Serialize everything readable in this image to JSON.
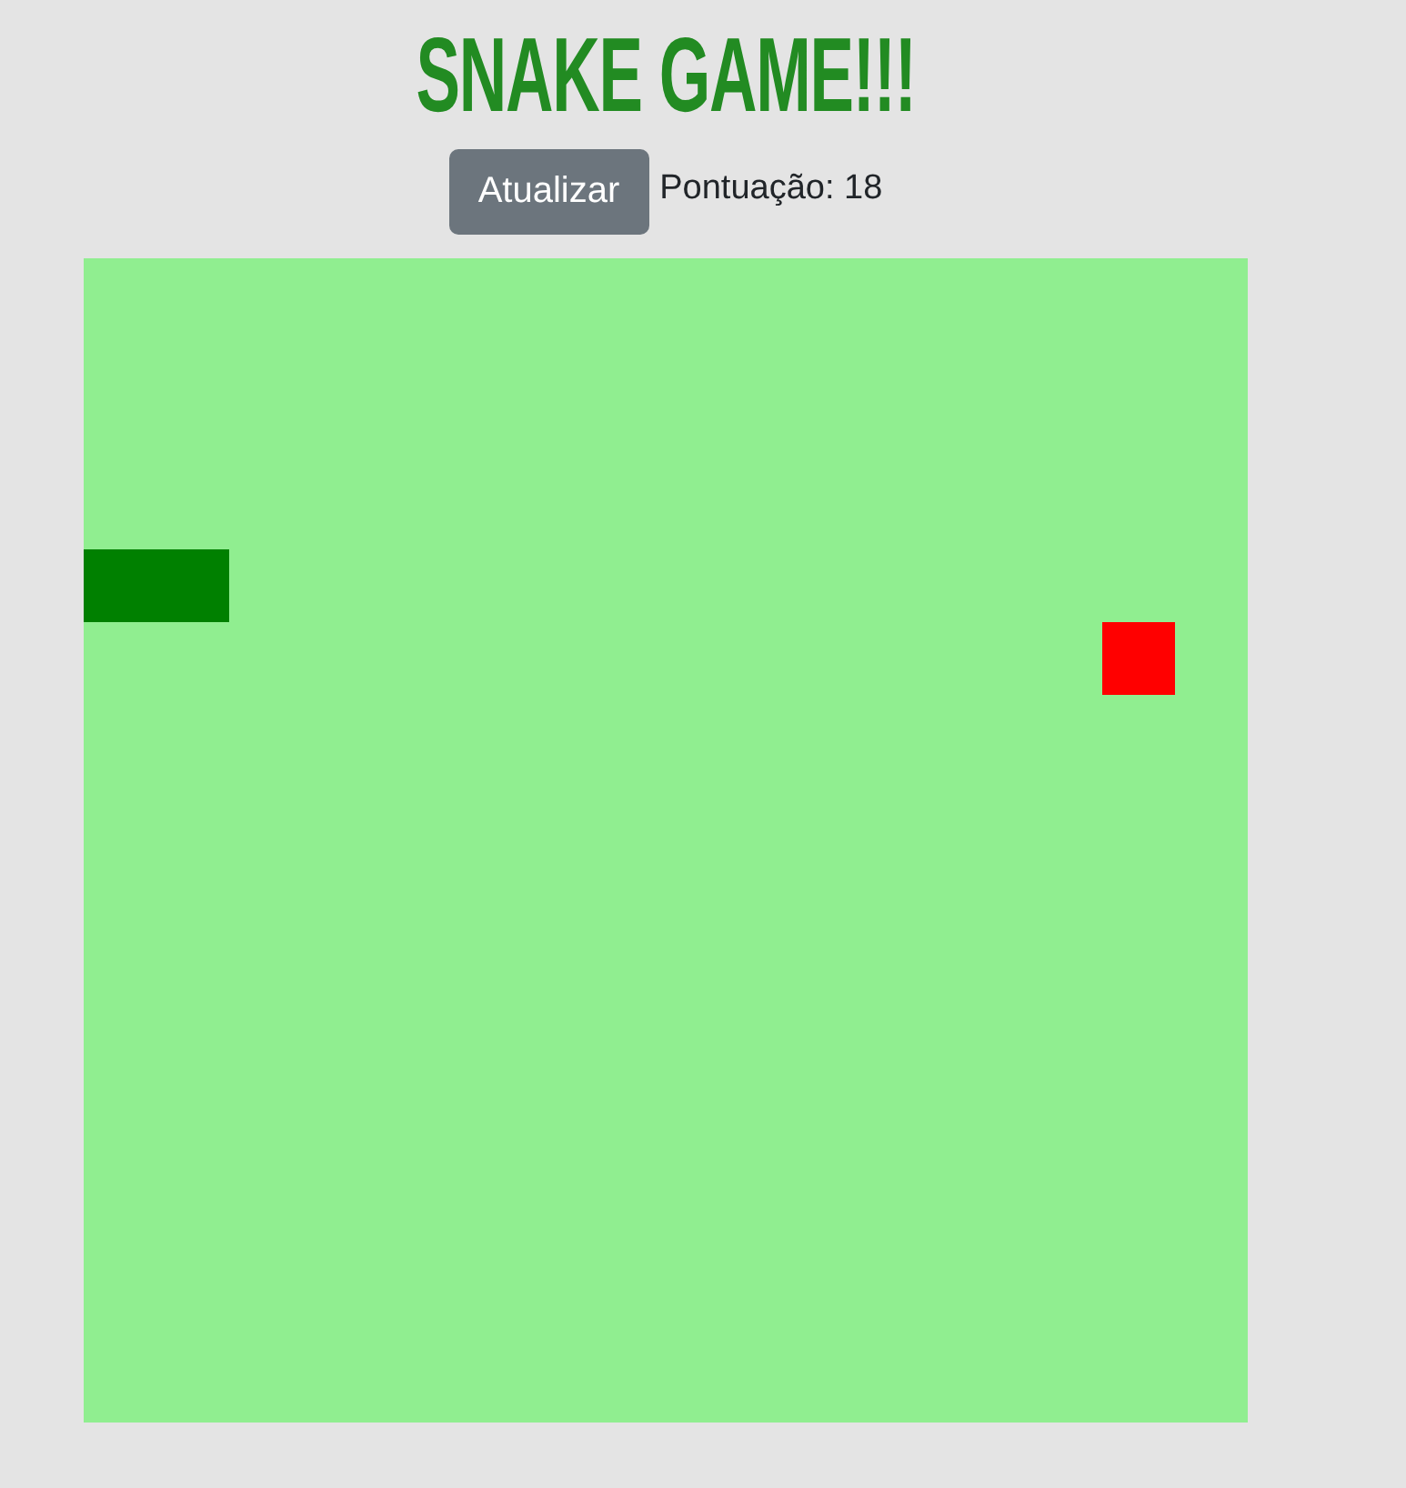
{
  "title": "SNAKE GAME!!!",
  "controls": {
    "refresh_button": "Atualizar",
    "score": "Pontuação: 18"
  },
  "board": {
    "pieces": [
      {
        "kind": "snake"
      },
      {
        "kind": "food"
      }
    ]
  }
}
